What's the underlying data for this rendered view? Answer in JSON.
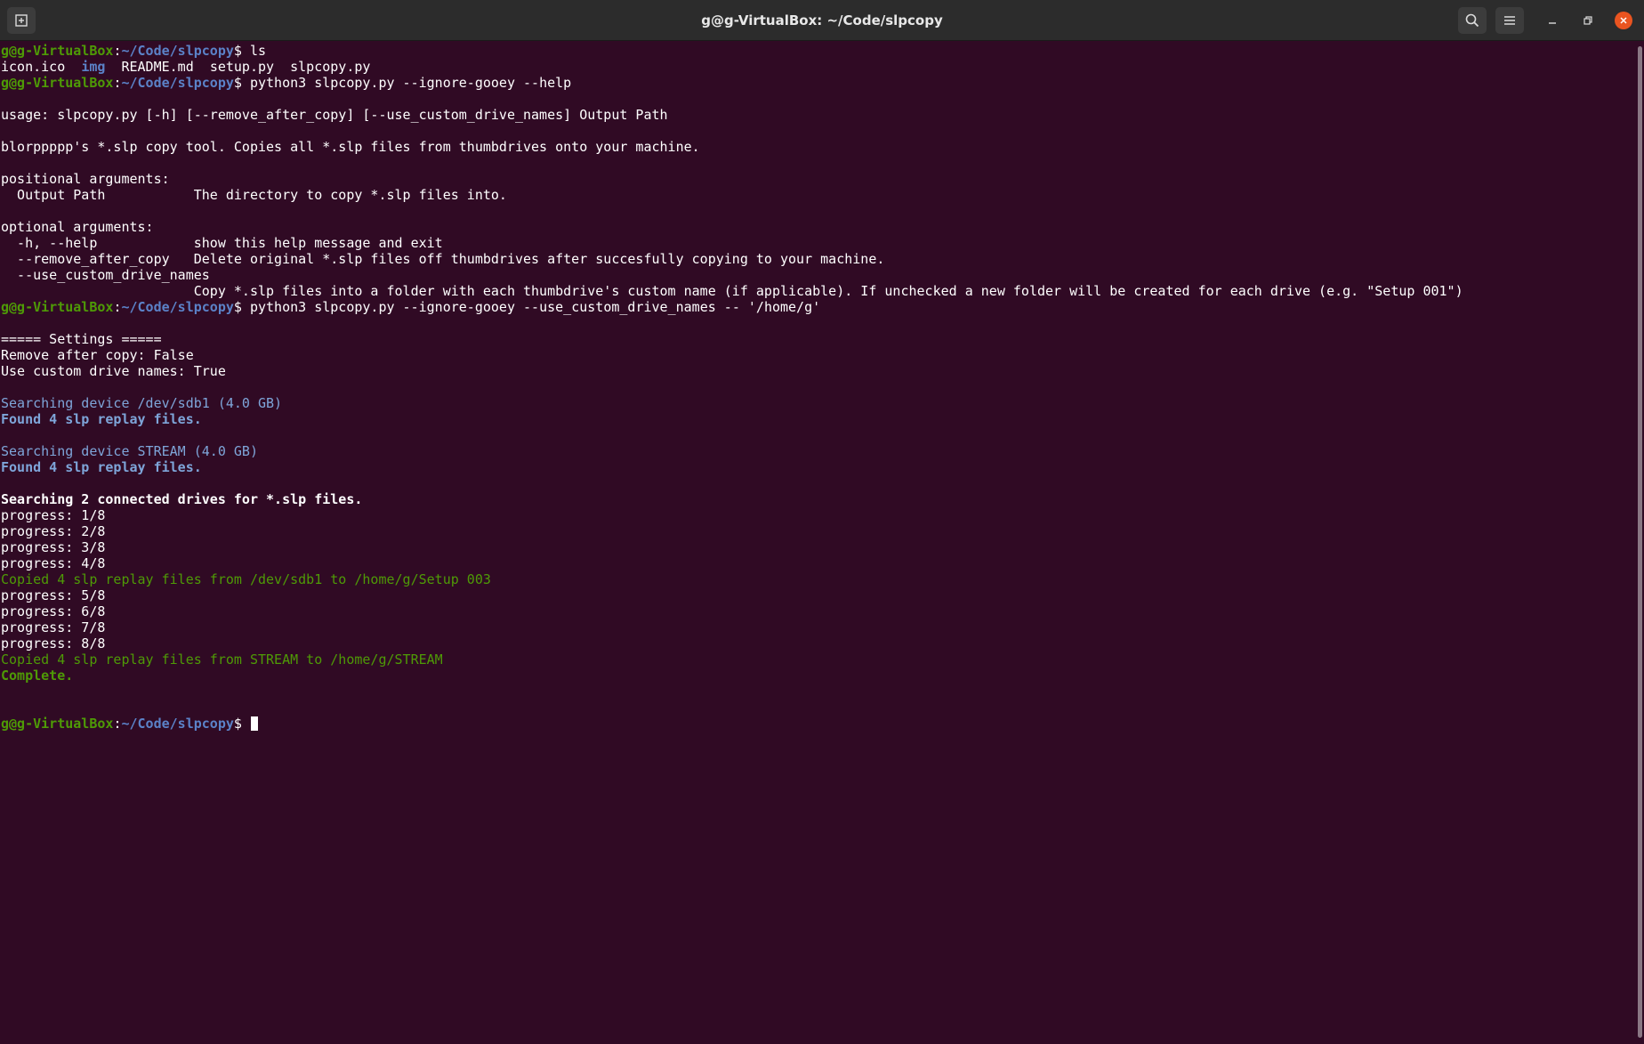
{
  "window": {
    "title": "g@g-VirtualBox: ~/Code/slpcopy"
  },
  "titlebar": {
    "new_tab_icon": "new-tab-icon",
    "search_icon": "search-icon",
    "menu_icon": "hamburger-menu-icon",
    "minimize_icon": "minimize-icon",
    "maximize_icon": "maximize-icon",
    "close_icon": "close-icon",
    "close_color": "#e95420"
  },
  "prompt": {
    "user": "g@g-VirtualBox",
    "sep": ":",
    "path": "~/Code/slpcopy",
    "symbol": "$ "
  },
  "colors": {
    "background": "#300a24",
    "prompt_user": "#4e9a06",
    "prompt_path": "#5b82c8",
    "info_blue": "#7ea5d9",
    "success_green": "#4e9a06"
  },
  "terminal": {
    "cmd1": "ls",
    "ls": {
      "f1": "icon.ico",
      "f2": "img",
      "f3": "README.md",
      "f4": "setup.py",
      "f5": "slpcopy.py"
    },
    "cmd2": "python3 slpcopy.py --ignore-gooey --help",
    "help": {
      "usage": "usage: slpcopy.py [-h] [--remove_after_copy] [--use_custom_drive_names] Output Path",
      "desc": "blorppppp's *.slp copy tool. Copies all *.slp files from thumbdrives onto your machine.",
      "pos_header": "positional arguments:",
      "pos1": "  Output Path           The directory to copy *.slp files into.",
      "opt_header": "optional arguments:",
      "opt1": "  -h, --help            show this help message and exit",
      "opt2": "  --remove_after_copy   Delete original *.slp files off thumbdrives after succesfully copying to your machine.",
      "opt3": "  --use_custom_drive_names",
      "opt3_desc": "                        Copy *.slp files into a folder with each thumbdrive's custom name (if applicable). If unchecked a new folder will be created for each drive (e.g. \"Setup 001\")"
    },
    "cmd3": "python3 slpcopy.py --ignore-gooey --use_custom_drive_names -- '/home/g'",
    "run": {
      "settings_header": "===== Settings =====",
      "setting1": "Remove after copy: False",
      "setting2": "Use custom drive names: True",
      "search1": "Searching device /dev/sdb1 (4.0 GB)",
      "found1": "Found 4 slp replay files.",
      "search2": "Searching device STREAM (4.0 GB)",
      "found2": "Found 4 slp replay files.",
      "searching_all": "Searching 2 connected drives for *.slp files.",
      "p1": "progress: 1/8",
      "p2": "progress: 2/8",
      "p3": "progress: 3/8",
      "p4": "progress: 4/8",
      "copied1": "Copied 4 slp replay files from /dev/sdb1 to /home/g/Setup 003",
      "p5": "progress: 5/8",
      "p6": "progress: 6/8",
      "p7": "progress: 7/8",
      "p8": "progress: 8/8",
      "copied2": "Copied 4 slp replay files from STREAM to /home/g/STREAM",
      "complete": "Complete."
    }
  }
}
